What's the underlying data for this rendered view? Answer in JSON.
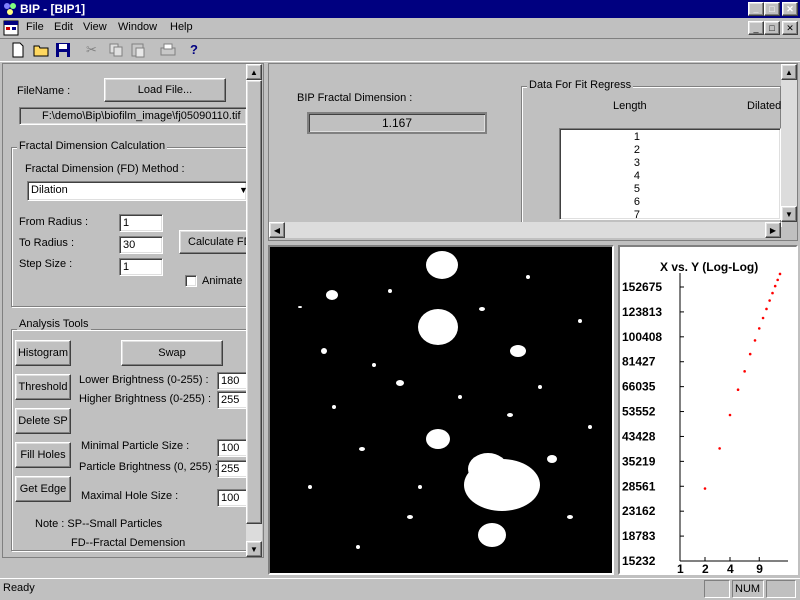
{
  "window": {
    "title": "BIP - [BIP1]"
  },
  "menu": [
    "File",
    "Edit",
    "View",
    "Window",
    "Help"
  ],
  "file": {
    "name_label": "FileName :",
    "load_button": "Load File...",
    "path": "F:\\demo\\Bip\\biofilm_image\\fj05090110.tif"
  },
  "fdcalc": {
    "group_label": "Fractal Dimension Calculation",
    "method_label": "Fractal Dimension (FD) Method :",
    "method_value": "Dilation",
    "from_label": "From Radius :",
    "from_value": "1",
    "to_label": "To Radius :",
    "to_value": "30",
    "step_label": "Step Size :",
    "step_value": "1",
    "calc_button": "Calculate FD",
    "animate_label": "Animate"
  },
  "tools": {
    "group_label": "Analysis Tools",
    "histogram": "Histogram",
    "swap": "Swap",
    "threshold": "Threshold",
    "lower_label": "Lower Brightness (0-255) :",
    "lower_value": "180",
    "higher_label": "Higher Brightness (0-255) :",
    "higher_value": "255",
    "delete_sp": "Delete SP",
    "fill_holes": "Fill Holes",
    "min_particle_label": "Minimal Particle Size :",
    "min_particle_value": "100",
    "particle_bright_label": "Particle Brightness (0, 255) :",
    "particle_bright_value": "255",
    "get_edge": "Get Edge",
    "max_hole_label": "Maximal Hole Size :",
    "max_hole_value": "100",
    "note_line1": "Note :   SP--Small Particles",
    "note_line2": "FD--Fractal Demension"
  },
  "results": {
    "fd_label": "BIP Fractal Dimension :",
    "fd_value": "1.167",
    "fit_group": "Data For Fit Regress",
    "col_length": "Length",
    "col_dilated": "Dilated",
    "rows": [
      "1",
      "2",
      "3",
      "4",
      "5",
      "6",
      "7"
    ]
  },
  "status": {
    "text": "Ready",
    "num": "NUM"
  },
  "chart_data": {
    "type": "scatter",
    "title": "X vs. Y (Log-Log)",
    "y_ticks": [
      "152675",
      "123813",
      "100408",
      "81427",
      "66035",
      "53552",
      "43428",
      "35219",
      "28561",
      "23162",
      "18783",
      "15232"
    ],
    "x_ticks": [
      "1",
      "2",
      "4",
      "9"
    ],
    "log_scale": true,
    "ylim": [
      15232,
      152675
    ],
    "xlim": [
      1,
      16
    ],
    "marker_color": "#ff0000",
    "series": [
      {
        "x": [
          2,
          3,
          4,
          5,
          6,
          7,
          8,
          9,
          10,
          11,
          12,
          13,
          14,
          15,
          16
        ],
        "y": [
          27200,
          37500,
          49000,
          60000,
          69500,
          79800,
          89000,
          98000,
          106500,
          114500,
          122500,
          130000,
          137500,
          144500,
          151500
        ]
      }
    ]
  },
  "colors": {
    "title_bar": "#000080",
    "face": "#c0c0c0",
    "marker": "#ff0000"
  }
}
